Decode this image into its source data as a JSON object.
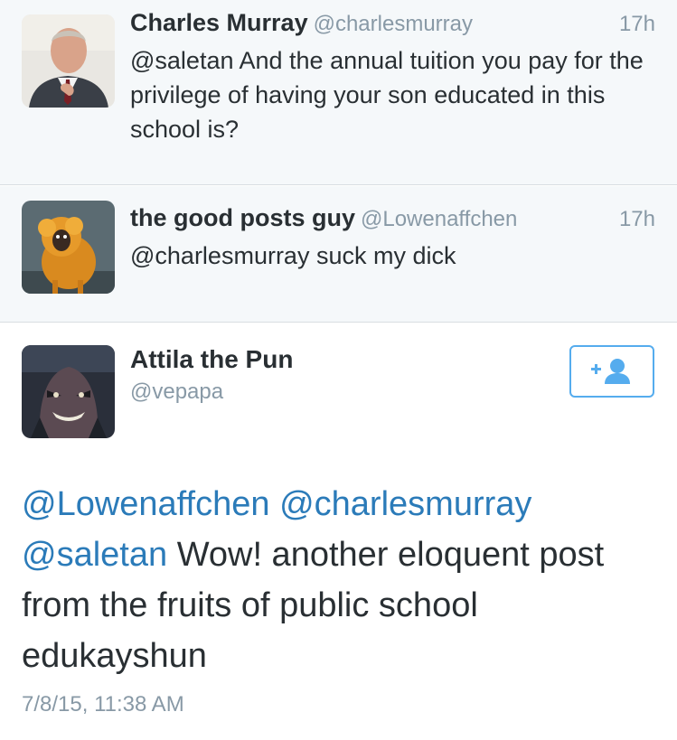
{
  "tweets": [
    {
      "name": "Charles Murray",
      "handle": "@charlesmurray",
      "time": "17h",
      "text": "@saletan And the annual tuition you pay for the privilege of having your son educated in this school is?",
      "avatar": "man-in-suit-avatar"
    },
    {
      "name": "the good posts guy",
      "handle": "@Lowenaffchen",
      "time": "17h",
      "text": "@charlesmurray suck my dick",
      "avatar": "golden-monkey-avatar"
    }
  ],
  "detail": {
    "name": "Attila the Pun",
    "handle": "@vepapa",
    "avatar": "cartoon-villain-avatar",
    "follow_icon": "add-user-icon",
    "mentions": [
      "@Lowenaffchen",
      "@charlesmurray",
      "@saletan"
    ],
    "body": "Wow! another eloquent post from the fruits of public school edukayshun",
    "timestamp": "7/8/15, 11:38 AM"
  },
  "colors": {
    "link": "#2b7bb9",
    "button": "#55acee",
    "muted": "#8899a6",
    "tweet_bg": "#f5f8fa"
  }
}
